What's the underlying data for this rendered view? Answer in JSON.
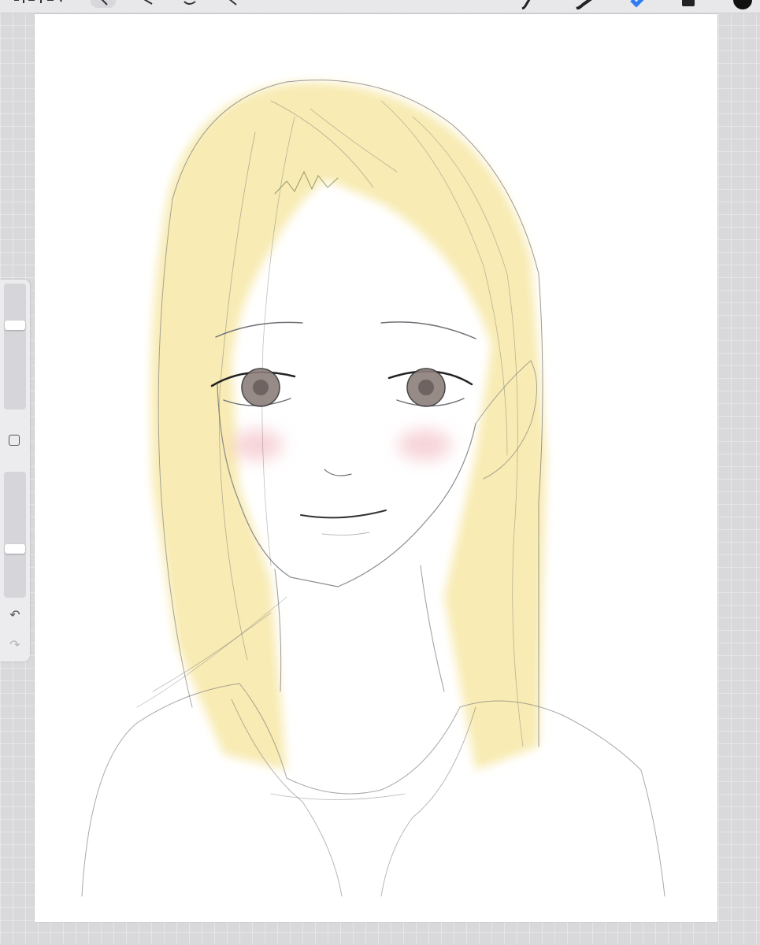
{
  "app": {
    "accent_color": "#2f7bf5",
    "active_color": "#111111"
  },
  "topbar": {
    "left_tools": [
      {
        "name": "gallery-icon"
      },
      {
        "name": "wrench-icon"
      },
      {
        "name": "magic-wand-icon"
      },
      {
        "name": "selection-icon"
      },
      {
        "name": "transform-icon"
      }
    ],
    "right_tools": [
      {
        "name": "brush-icon"
      },
      {
        "name": "smudge-icon"
      },
      {
        "name": "eraser-icon"
      },
      {
        "name": "layers-icon"
      },
      {
        "name": "color-icon"
      }
    ]
  },
  "sidebar": {
    "brush_size_level": 0.68,
    "opacity_level": 0.38,
    "modify_icon": "square-icon",
    "undo_icon": "undo-icon",
    "redo_icon": "redo-icon"
  },
  "canvas": {
    "background": "#ffffff",
    "hair_color": "#f7e7a6",
    "line_color": "#6f7076",
    "blush_color": "#f2b8c0",
    "eye_color": "#8c7f7b"
  }
}
